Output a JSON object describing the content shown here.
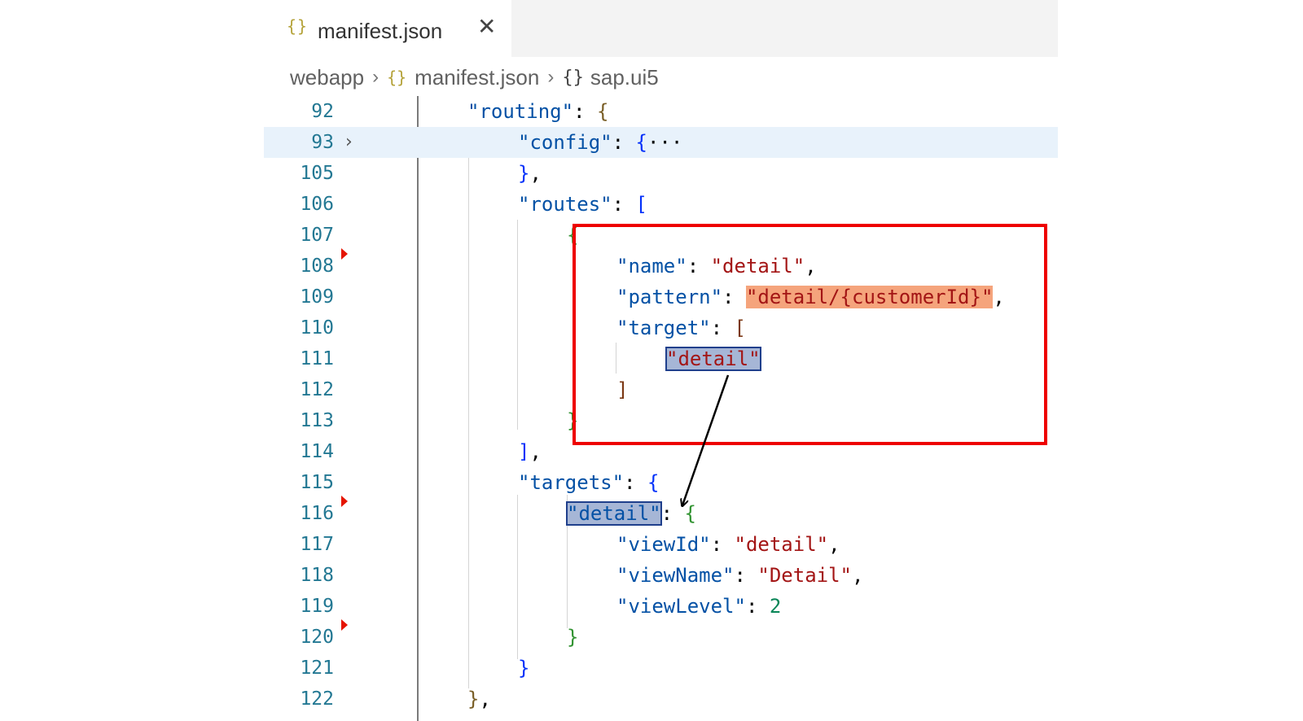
{
  "tab": {
    "icon": "{}",
    "label": "manifest.json",
    "close_glyph": "✕"
  },
  "breadcrumb": {
    "folder": "webapp",
    "file_icon": "{}",
    "file": "manifest.json",
    "obj_icon": "{}",
    "node": "sap.ui5",
    "separator": "›"
  },
  "gutter": {
    "fold_glyph": "›"
  },
  "code": {
    "l92": {
      "num": "92",
      "key": "\"routing\"",
      "colon": ": ",
      "brace": "{"
    },
    "l93": {
      "num": "93",
      "key": "\"config\"",
      "colon": ": ",
      "brace": "{",
      "ellipsis": "···"
    },
    "l105": {
      "num": "105",
      "close": "}",
      "comma": ","
    },
    "l106": {
      "num": "106",
      "key": "\"routes\"",
      "colon": ": ",
      "bracket": "["
    },
    "l107": {
      "num": "107",
      "brace": "{"
    },
    "l108": {
      "num": "108",
      "key": "\"name\"",
      "colon": ": ",
      "value": "\"detail\"",
      "comma": ","
    },
    "l109": {
      "num": "109",
      "key": "\"pattern\"",
      "colon": ": ",
      "value": "\"detail/{customerId}\"",
      "comma": ","
    },
    "l110": {
      "num": "110",
      "key": "\"target\"",
      "colon": ": ",
      "bracket": "["
    },
    "l111": {
      "num": "111",
      "value": "\"detail\""
    },
    "l112": {
      "num": "112",
      "bracket": "]"
    },
    "l113": {
      "num": "113",
      "brace": "}"
    },
    "l114": {
      "num": "114",
      "bracket": "]",
      "comma": ","
    },
    "l115": {
      "num": "115",
      "key": "\"targets\"",
      "colon": ": ",
      "brace": "{"
    },
    "l116": {
      "num": "116",
      "key": "\"detail\"",
      "colon": ": ",
      "brace": "{"
    },
    "l117": {
      "num": "117",
      "key": "\"viewId\"",
      "colon": ": ",
      "value": "\"detail\"",
      "comma": ","
    },
    "l118": {
      "num": "118",
      "key": "\"viewName\"",
      "colon": ": ",
      "value": "\"Detail\"",
      "comma": ","
    },
    "l119": {
      "num": "119",
      "key": "\"viewLevel\"",
      "colon": ": ",
      "value": "2"
    },
    "l120": {
      "num": "120",
      "brace": "}"
    },
    "l121": {
      "num": "121",
      "brace": "}"
    },
    "l122": {
      "num": "122",
      "brace": "}",
      "comma": ","
    }
  },
  "colors": {
    "annotation_box": "#ee0000",
    "arrow": "#000000",
    "highlight_orange": "#f5a47c",
    "selection": "#a6b6d6"
  },
  "icons": {
    "tab": "json-braces-icon",
    "close": "close-icon",
    "fold": "chevron-right-icon"
  }
}
